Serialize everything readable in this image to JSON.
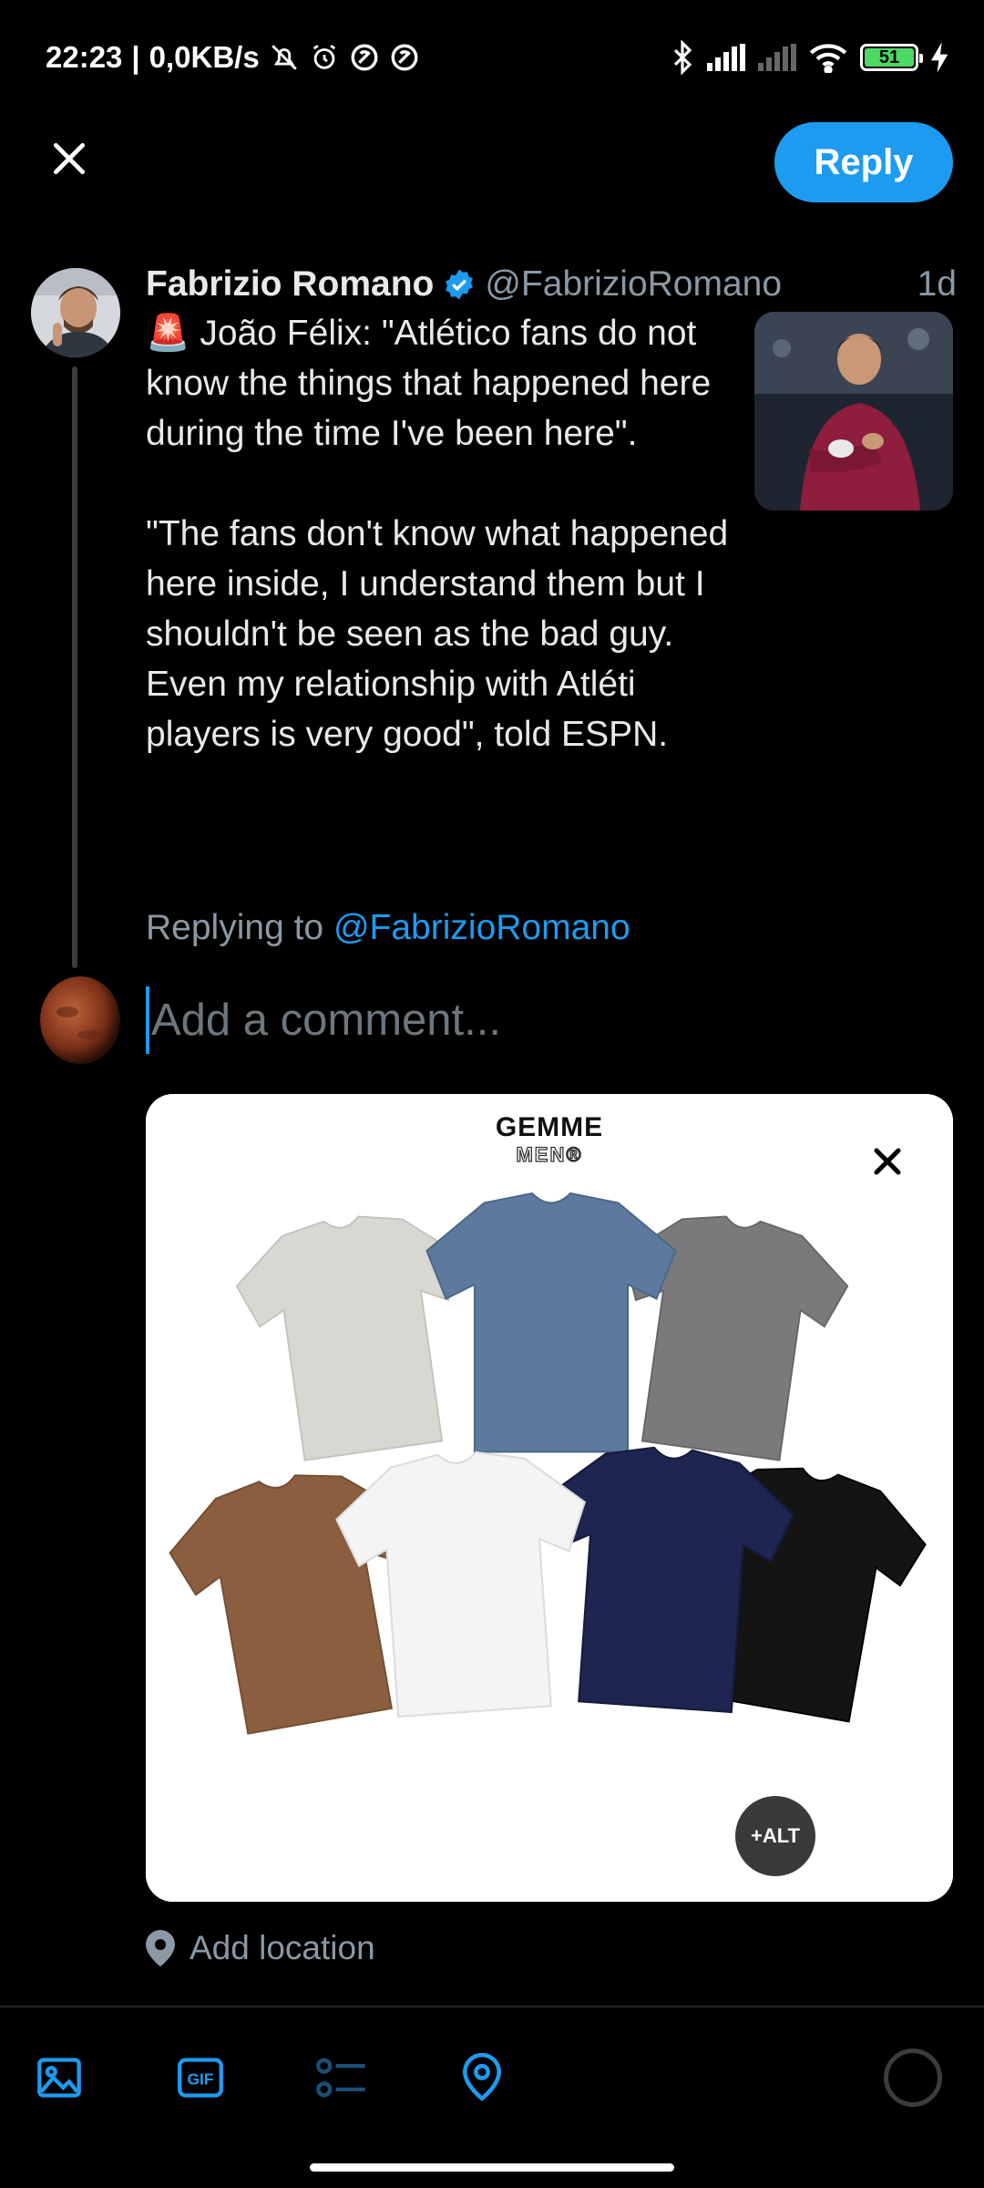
{
  "status_bar": {
    "time": "22:23",
    "network_speed": "0,0KB/s",
    "battery_level": "51",
    "icons": [
      "mute-icon",
      "alarm-icon",
      "data-saver-icon",
      "data-saver-icon",
      "bluetooth-icon",
      "signal-icon",
      "signal-icon",
      "wifi-icon",
      "battery-icon",
      "charging-icon"
    ]
  },
  "header": {
    "reply_label": "Reply"
  },
  "tweet": {
    "author_name": "Fabrizio Romano",
    "handle": "@FabrizioRomano",
    "time": "1d",
    "emoji": "🚨",
    "text": " João Félix: \"Atlético fans do not know the things that happened here during the time I've been here\".\n\n\"The fans don't know what happened here inside, I understand them but I shouldn't be seen as the bad guy. Even my relationship with Atléti players is very good\", told ESPN.",
    "replying_prefix": "Replying to ",
    "replying_mention": "@FabrizioRomano"
  },
  "composer": {
    "placeholder": "Add a comment...",
    "value": ""
  },
  "media": {
    "brand_line1": "GEMME",
    "brand_line2": "MEN®",
    "alt_label": "+ALT",
    "shirt_colors": [
      "#d9d7d1",
      "#5d7a9e",
      "#7a7a7c",
      "#8a5e3e",
      "#f4f4f4",
      "#1d2550",
      "#141414"
    ]
  },
  "location": {
    "label": "Add location"
  },
  "toolbar": {
    "tools": [
      "image-icon",
      "gif-icon",
      "poll-icon",
      "location-icon"
    ],
    "accent": "#1d9bf0",
    "disabled": "#1b4f76"
  }
}
